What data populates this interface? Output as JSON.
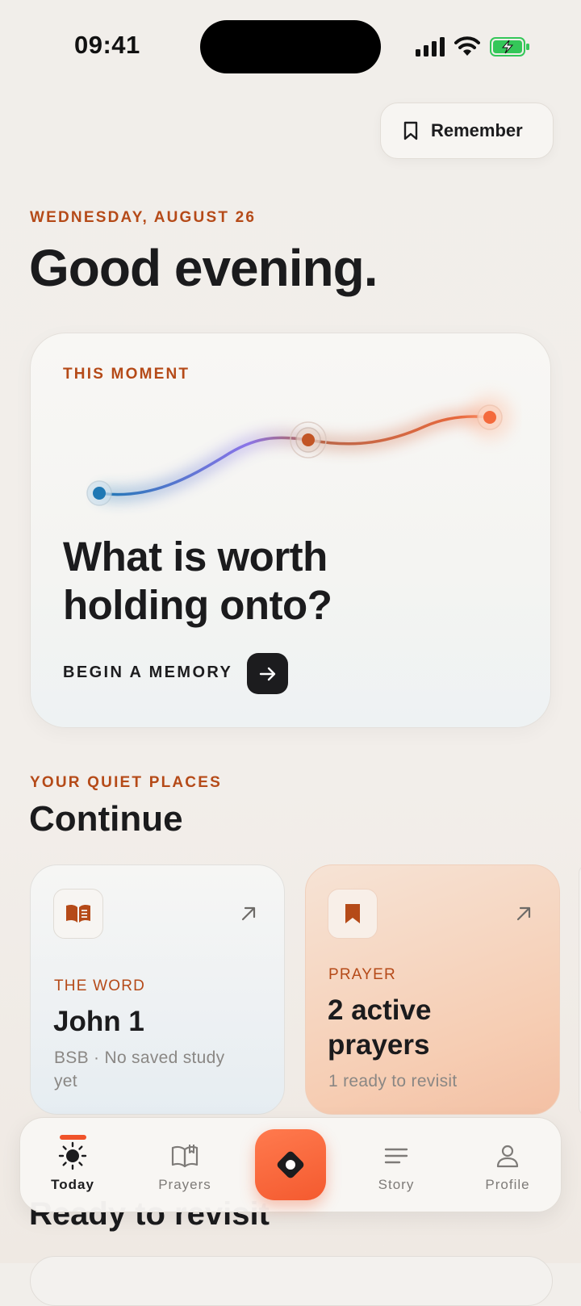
{
  "status_bar": {
    "time": "09:41"
  },
  "header": {
    "remember_label": "Remember"
  },
  "greeting": {
    "date": "WEDNESDAY, AUGUST 26",
    "title": "Good evening."
  },
  "moment_card": {
    "eyebrow": "THIS MOMENT",
    "title_line1": "What is worth",
    "title_line2": "holding onto?",
    "cta_label": "BEGIN A MEMORY"
  },
  "quiet_places": {
    "eyebrow": "YOUR QUIET PLACES",
    "title": "Continue",
    "cards": [
      {
        "eyebrow": "THE WORD",
        "title": "John 1",
        "subtitle_line1": "BSB · No saved study",
        "subtitle_line2": "yet",
        "icon": "book-icon"
      },
      {
        "eyebrow": "PRAYER",
        "title_line1": "2 active",
        "title_line2": "prayers",
        "subtitle": "1 ready to revisit",
        "icon": "bookmark-icon"
      }
    ]
  },
  "revisit": {
    "title": "Ready to revisit"
  },
  "tab_bar": {
    "active": "Today",
    "tabs": [
      {
        "label": "Today",
        "icon": "sun-icon"
      },
      {
        "label": "Prayers",
        "icon": "open-book-icon"
      },
      {
        "label": "Story",
        "icon": "lines-icon"
      },
      {
        "label": "Profile",
        "icon": "person-icon"
      }
    ],
    "center_icon": "diamond-icon"
  },
  "colors": {
    "accent": "#b54a18",
    "brand_orange": "#f45a2f",
    "ink": "#1c1c1e"
  }
}
